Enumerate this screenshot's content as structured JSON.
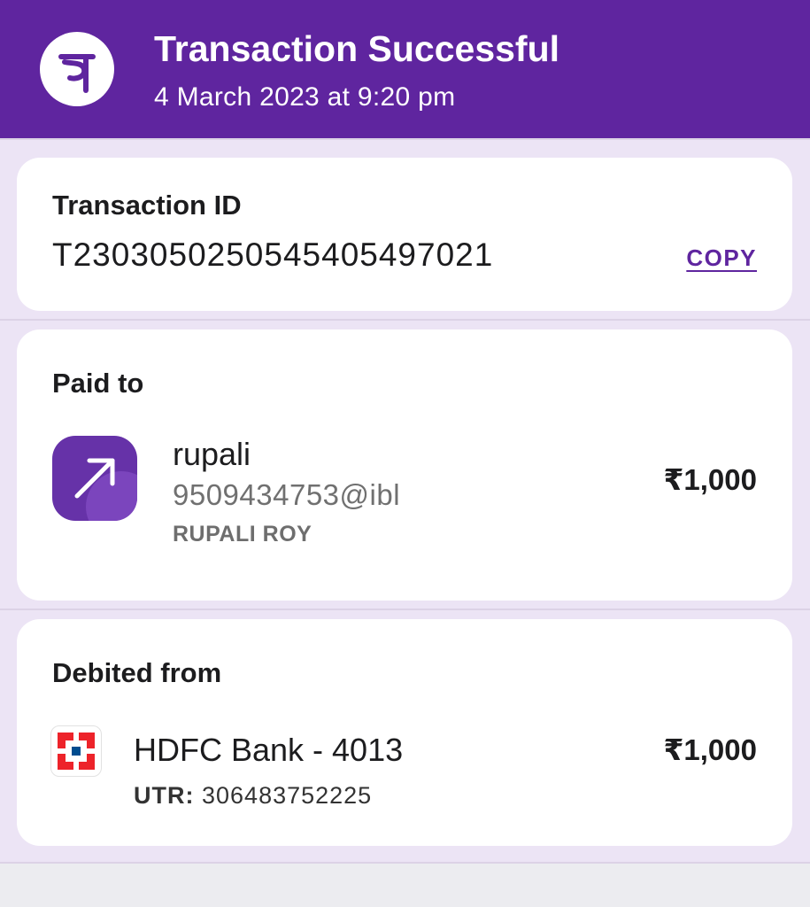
{
  "header": {
    "title": "Transaction Successful",
    "datetime": "4 March 2023 at 9:20 pm",
    "logo_icon": "phonepe-logo",
    "brand_color": "#5f259f"
  },
  "transaction": {
    "label": "Transaction ID",
    "id": "T2303050250545405497021",
    "copy_label": "COPY"
  },
  "paid_to": {
    "label": "Paid to",
    "icon": "arrow-up-right-icon",
    "name": "rupali",
    "upi_id": "9509434753@ibl",
    "full_name": "RUPALI ROY",
    "amount": "₹1,000"
  },
  "debited_from": {
    "label": "Debited from",
    "bank_icon": "hdfc-bank-icon",
    "bank": "HDFC Bank - 4013",
    "utr_label": "UTR:",
    "utr_value": "306483752225",
    "amount": "₹1,000"
  }
}
